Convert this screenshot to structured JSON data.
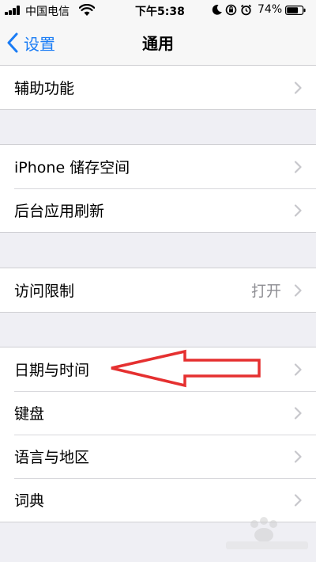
{
  "status_bar": {
    "carrier": "中国电信",
    "time": "下午5:38",
    "battery_percent": "74%",
    "battery_level": 0.74,
    "icons": [
      "signal-icon",
      "wifi-icon",
      "moon-icon",
      "orientation-lock-icon",
      "alarm-icon",
      "battery-icon"
    ]
  },
  "nav": {
    "back_label": "设置",
    "title": "通用"
  },
  "groups": [
    {
      "items": [
        {
          "label": "辅助功能"
        }
      ]
    },
    {
      "items": [
        {
          "label": "iPhone 储存空间"
        },
        {
          "label": "后台应用刷新"
        }
      ]
    },
    {
      "items": [
        {
          "label": "访问限制",
          "value": "打开"
        }
      ]
    },
    {
      "items": [
        {
          "label": "日期与时间"
        },
        {
          "label": "键盘"
        },
        {
          "label": "语言与地区"
        },
        {
          "label": "词典"
        }
      ]
    }
  ],
  "colors": {
    "accent": "#1a7cf5",
    "annotation": "#e53030",
    "background": "#efeff4"
  }
}
